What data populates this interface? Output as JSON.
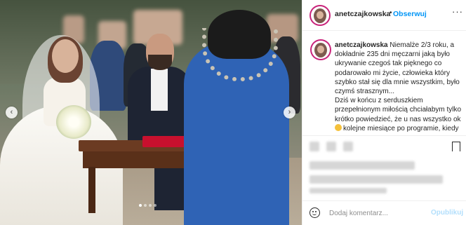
{
  "post": {
    "username": "anetczajkowska",
    "follow_label": "Obserwuj",
    "separator": "•",
    "more_label": "···"
  },
  "caption": {
    "username": "anetczajkowska",
    "text": "Niemalże 2/3 roku, a dokładnie 235 dni męczarni jaką było ukrywanie czegoś tak pięknego co podarowało mi życie, człowieka który szybko stał się dla mnie wszystkim, było czymś strasznym...",
    "text2": "Dziś w końcu z serduszkiem przepełnionym miłością chciałabym tylko krótko powiedzieć, że u nas wszystko ok",
    "text3": "kolejne miesiące po programie, kiedy"
  },
  "comment": {
    "placeholder": "Dodaj komentarz...",
    "publish_label": "Opublikuj"
  },
  "carousel": {
    "prev": "‹",
    "next": "›",
    "slides": 4,
    "active": 1
  },
  "colors": {
    "link": "#0095f6",
    "publish_disabled": "#b2dffc",
    "avatar_ring": "#c9237a",
    "text": "#262626",
    "muted": "#8e8e8e"
  },
  "icons": [
    "more-options-icon",
    "bookmark-icon",
    "emoji-icon",
    "chevron-left-icon",
    "chevron-right-icon"
  ]
}
